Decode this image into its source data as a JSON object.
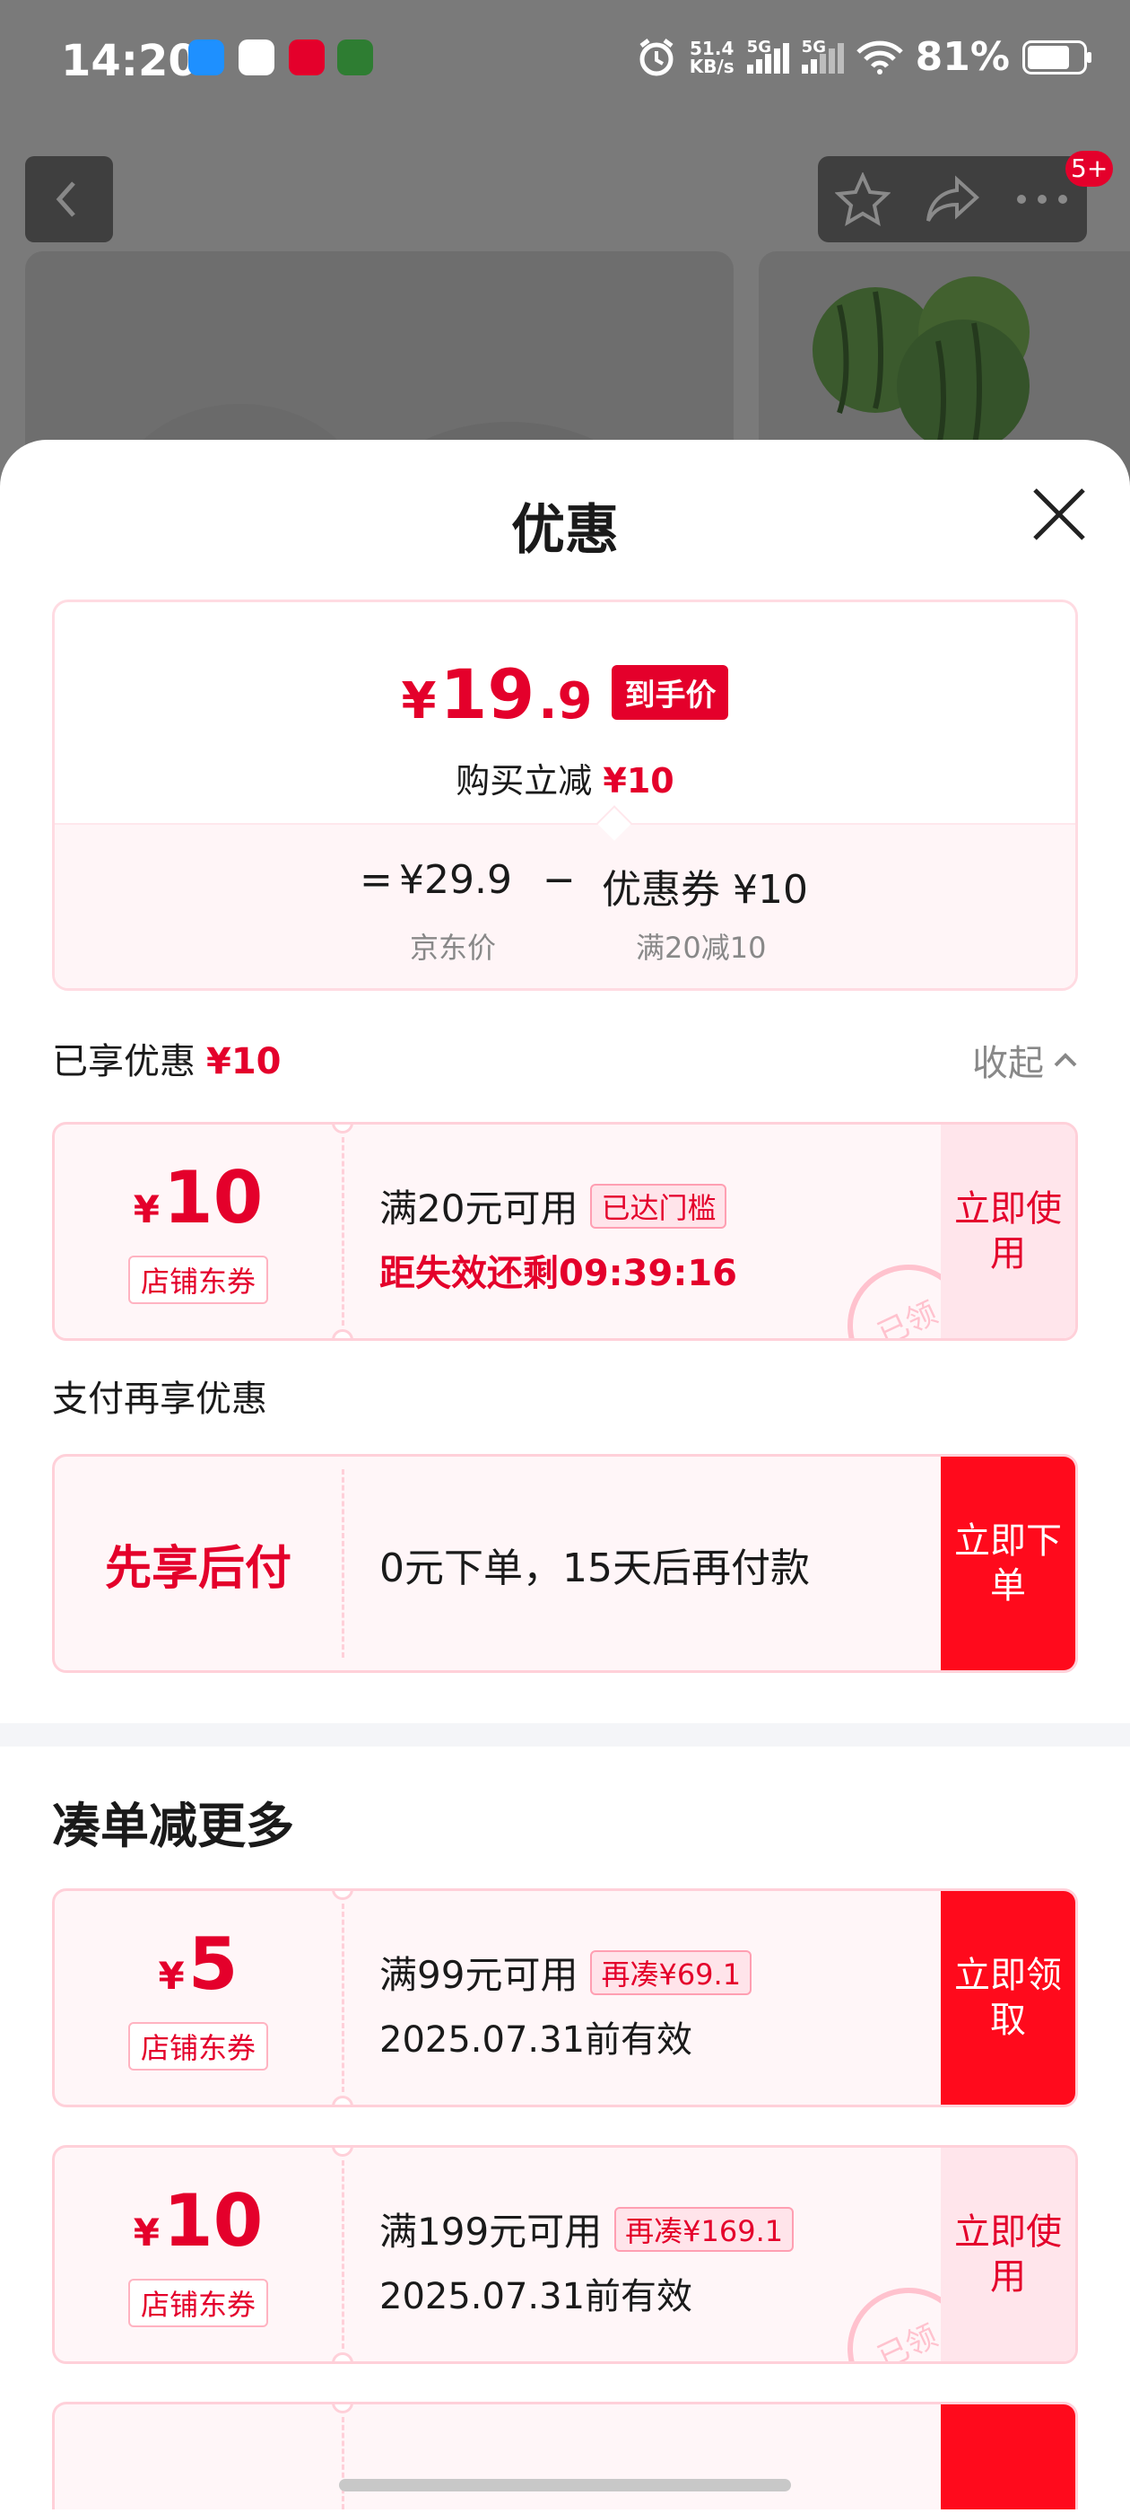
{
  "status_bar": {
    "time": "14:20",
    "net_speed_value": "51.4",
    "net_speed_unit": "KB/s",
    "signal1_label": "5G",
    "signal2_label": "5G",
    "battery": "81%"
  },
  "top_nav": {
    "more_badge": "5+"
  },
  "sheet": {
    "title": "优惠",
    "price_card": {
      "final_price_yen": "¥",
      "final_price_int": "19",
      "final_price_dec": ".9",
      "final_tag": "到手价",
      "reduce_label": "购买立减",
      "reduce_value": "¥10",
      "equals": "=",
      "base_price": "¥29.9",
      "minus": "−",
      "coupon_label": "优惠券 ¥10",
      "base_price_label": "京东价",
      "coupon_rule": "满20减10"
    },
    "enjoyed": {
      "label": "已享优惠",
      "value": "¥10",
      "collapse": "收起"
    },
    "coupon_used": {
      "yen": "¥",
      "amount": "10",
      "type": "店铺东券",
      "condition": "满20元可用",
      "tag": "已达门槛",
      "countdown": "距失效还剩09:39:16",
      "button": "立即使用",
      "stamp": "已领"
    },
    "pay_section": {
      "label": "支付再享优惠",
      "title": "先享后付",
      "desc": "0元下单，15天后再付款",
      "button": "立即下单"
    },
    "more_section": {
      "label": "凑单减更多",
      "coupons": [
        {
          "yen": "¥",
          "amount": "5",
          "type": "店铺东券",
          "condition": "满99元可用",
          "tag": "再凑¥69.1",
          "validity": "2025.07.31前有效",
          "button": "立即领取"
        },
        {
          "yen": "¥",
          "amount": "10",
          "type": "店铺东券",
          "condition": "满199元可用",
          "tag": "再凑¥169.1",
          "validity": "2025.07.31前有效",
          "button": "立即使用",
          "stamp": "已领"
        }
      ]
    }
  }
}
